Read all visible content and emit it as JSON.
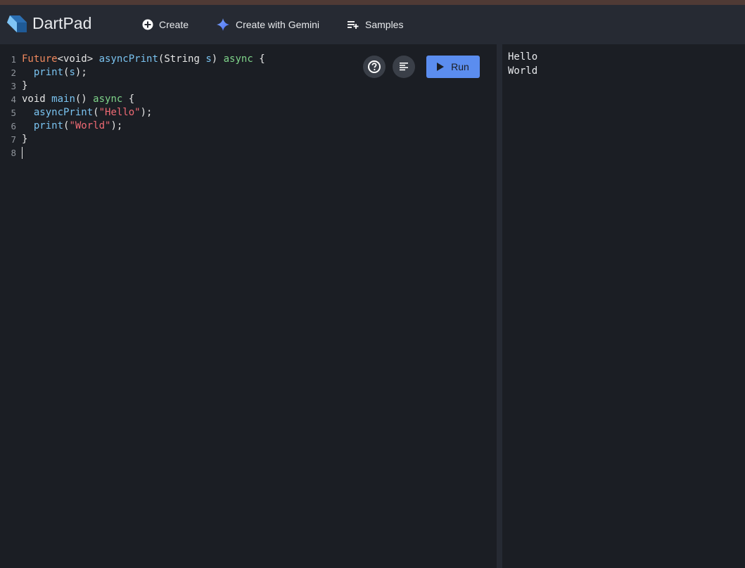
{
  "app": {
    "name": "DartPad"
  },
  "nav": {
    "create_label": "Create",
    "gemini_label": "Create with Gemini",
    "samples_label": "Samples"
  },
  "editor": {
    "line_numbers": [
      "1",
      "2",
      "3",
      "4",
      "5",
      "6",
      "7",
      "8"
    ],
    "lines": [
      [
        {
          "t": "Future",
          "c": "type"
        },
        {
          "t": "<void> ",
          "c": "plain"
        },
        {
          "t": "asyncPrint",
          "c": "fn"
        },
        {
          "t": "(String ",
          "c": "plain"
        },
        {
          "t": "s",
          "c": "fn"
        },
        {
          "t": ") ",
          "c": "plain"
        },
        {
          "t": "async",
          "c": "kw"
        },
        {
          "t": " {",
          "c": "plain"
        }
      ],
      [
        {
          "t": "  ",
          "c": "plain"
        },
        {
          "t": "print",
          "c": "fn"
        },
        {
          "t": "(",
          "c": "plain"
        },
        {
          "t": "s",
          "c": "fn"
        },
        {
          "t": ");",
          "c": "plain"
        }
      ],
      [
        {
          "t": "}",
          "c": "plain"
        }
      ],
      [
        {
          "t": "void ",
          "c": "plain"
        },
        {
          "t": "main",
          "c": "fn"
        },
        {
          "t": "() ",
          "c": "plain"
        },
        {
          "t": "async",
          "c": "kw"
        },
        {
          "t": " {",
          "c": "plain"
        }
      ],
      [
        {
          "t": "  ",
          "c": "plain"
        },
        {
          "t": "asyncPrint",
          "c": "fn"
        },
        {
          "t": "(",
          "c": "plain"
        },
        {
          "t": "\"Hello\"",
          "c": "str"
        },
        {
          "t": ");",
          "c": "plain"
        }
      ],
      [
        {
          "t": "  ",
          "c": "plain"
        },
        {
          "t": "print",
          "c": "fn"
        },
        {
          "t": "(",
          "c": "plain"
        },
        {
          "t": "\"World\"",
          "c": "str"
        },
        {
          "t": ");",
          "c": "plain"
        }
      ],
      [
        {
          "t": "}",
          "c": "plain"
        }
      ],
      []
    ]
  },
  "toolbar": {
    "help_icon": "help-circle-icon",
    "format_icon": "format-align-icon",
    "run_label": "Run"
  },
  "console": {
    "lines": [
      "Hello",
      "World"
    ]
  },
  "colors": {
    "accent": "#5b8def",
    "header_bg": "#262a33",
    "editor_bg": "#1b1e24"
  }
}
